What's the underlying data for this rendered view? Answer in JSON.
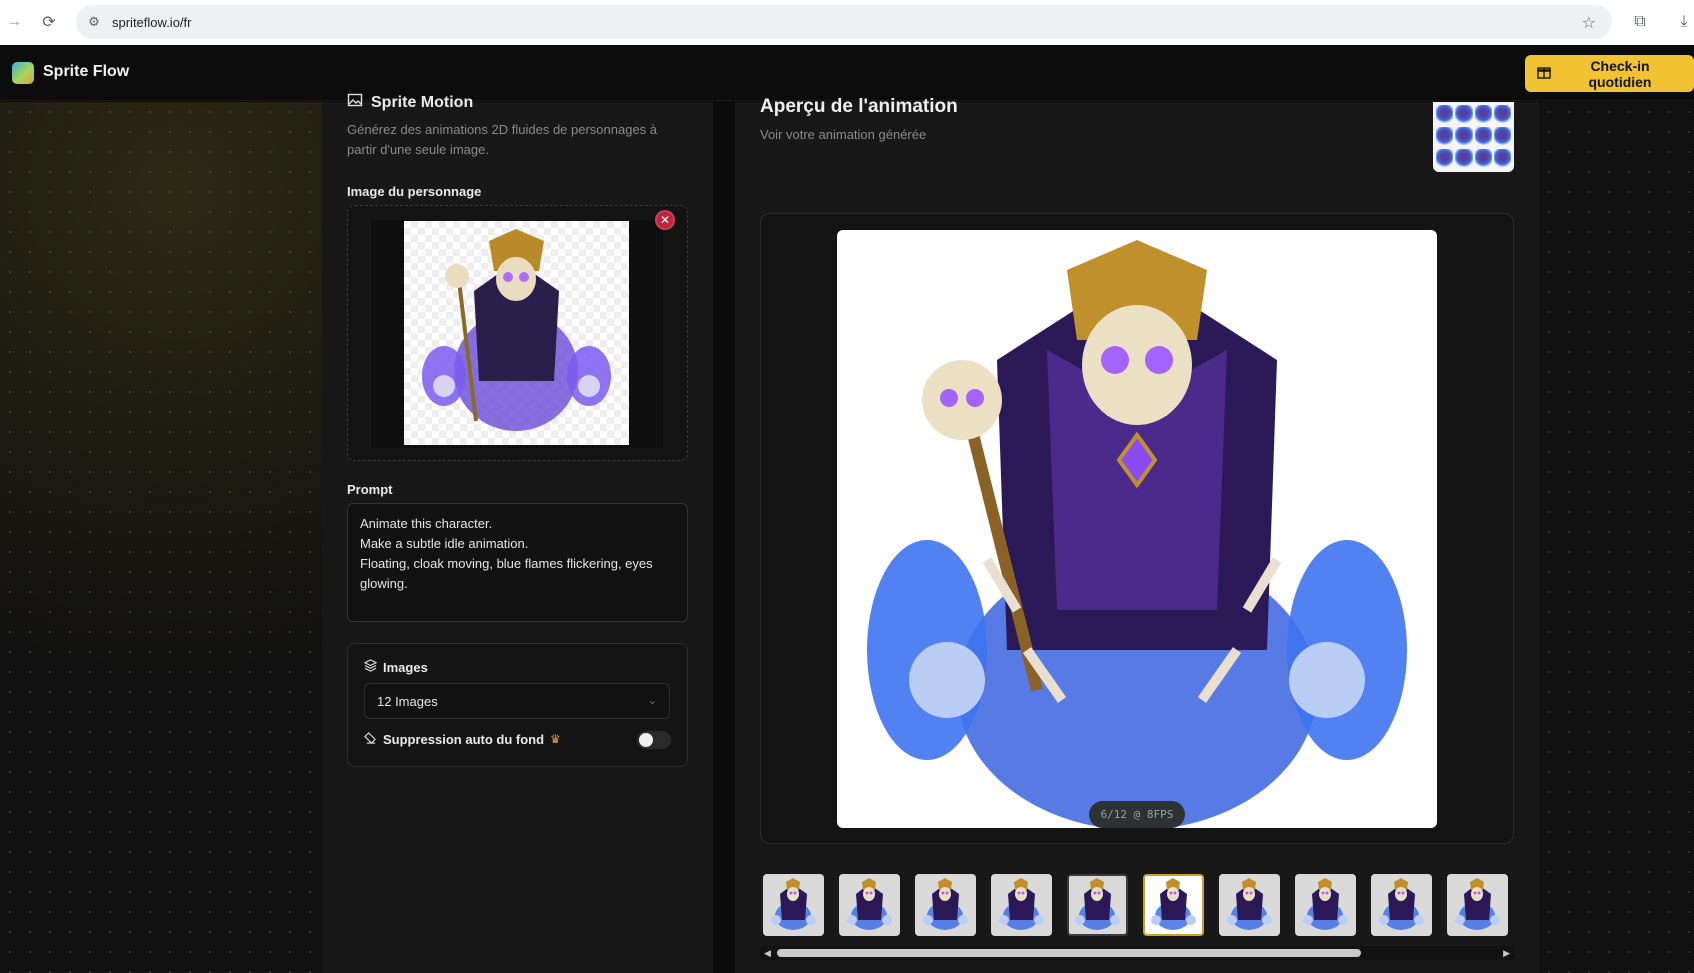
{
  "browser": {
    "url": "spriteflow.io/fr"
  },
  "header": {
    "brand": "Sprite Flow",
    "checkin_label": "Check-in quotidien"
  },
  "left": {
    "title": "Sprite Motion",
    "description": "Générez des animations 2D fluides de personnages à partir d'une seule image.",
    "image_label": "Image du personnage",
    "remove_glyph": "✕",
    "prompt_label": "Prompt",
    "prompt_value": "Animate this character.\nMake a subtle idle animation.\nFloating, cloak moving, blue flames flickering, eyes glowing.",
    "images_label": "Images",
    "images_selected": "12 Images",
    "bg_removal_label": "Suppression auto du fond",
    "bg_removal_enabled": false
  },
  "right": {
    "title": "Aperçu de l'animation",
    "subtitle": "Voir votre animation générée",
    "fps_badge": "6/12 @ 8FPS",
    "current_frame": 6,
    "total_frames": 12,
    "frames_visible": 10,
    "selected_frame": 6
  },
  "colors": {
    "accent": "#f1c232",
    "selected_border": "#c9a227",
    "remove": "#c0243c"
  },
  "icons": {
    "back": "arrow-right-icon",
    "reload": "reload-icon",
    "site": "site-settings-icon",
    "star": "star-icon",
    "extensions": "puzzle-icon",
    "download": "download-icon",
    "gift": "gift-icon",
    "layers": "layers-icon",
    "eraser": "eraser-icon",
    "crown": "crown-icon"
  }
}
